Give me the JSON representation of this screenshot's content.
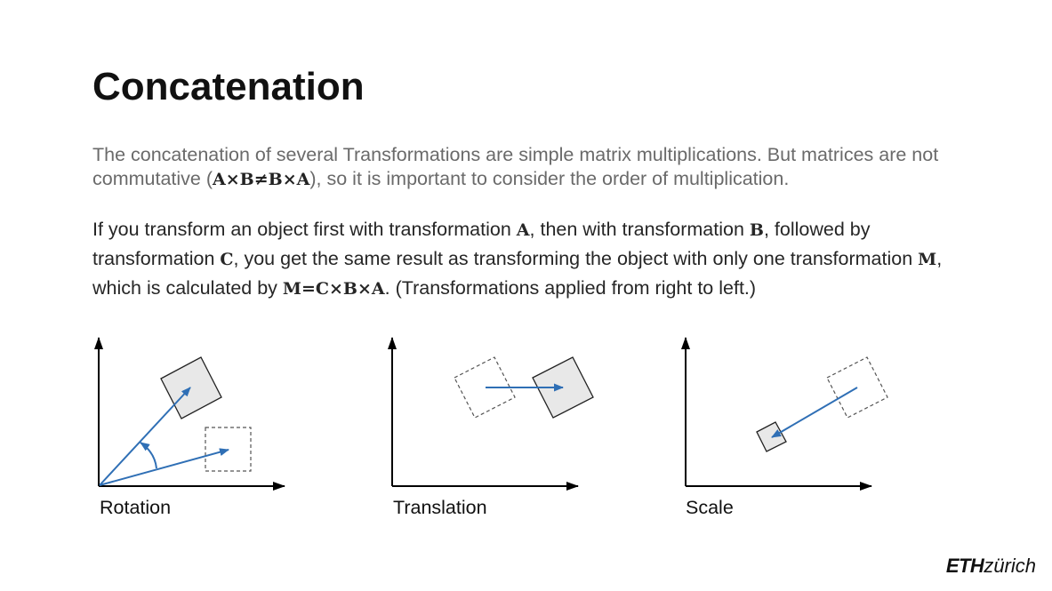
{
  "slide": {
    "title": "Concatenation",
    "para1": {
      "t1": "The concatenation of several Transformations are simple matrix multiplications. But matrices are not commutative (",
      "m1": "A×B≠B×A",
      "t2": "), so it is important to consider the order of multiplication."
    },
    "para2": {
      "t1": "If you transform an object first with transformation ",
      "m1": "A",
      "t2": ", then with transformation ",
      "m2": "B",
      "t3": ", followed by transformation ",
      "m3": "C",
      "t4": ", you get the same result as transforming the object with only one transformation ",
      "m4": "M",
      "t5": ", which is calculated by ",
      "m5": "M=C×B×A",
      "t6": ". (Transformations applied from right to left.)"
    }
  },
  "diagrams": {
    "rotation_label": "Rotation",
    "translation_label": "Translation",
    "scale_label": "Scale"
  },
  "logo": {
    "eth": "ETH",
    "zurich": "zürich"
  },
  "colors": {
    "arrow": "#2f6fb5",
    "shape_fill": "#e8e8e8",
    "axis": "#000000"
  }
}
